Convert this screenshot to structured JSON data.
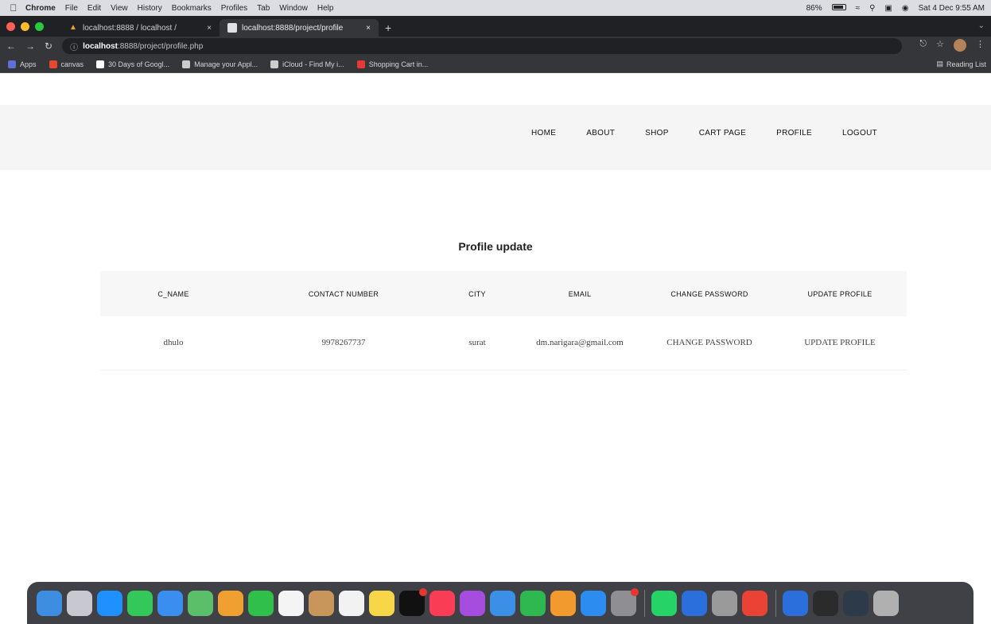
{
  "menubar": {
    "items": [
      "Chrome",
      "File",
      "Edit",
      "View",
      "History",
      "Bookmarks",
      "Profiles",
      "Tab",
      "Window",
      "Help"
    ],
    "battery": "86%",
    "clock": "Sat 4 Dec 9:55 AM"
  },
  "tabs": [
    {
      "title": "localhost:8888 / localhost / ",
      "close": "×"
    },
    {
      "title": "localhost:8888/project/profile",
      "close": "×"
    }
  ],
  "newtab": "+",
  "address": {
    "host": "localhost",
    "path": ":8888/project/profile.php"
  },
  "bookmarks": [
    {
      "label": "Apps",
      "color": "#5f6fd6"
    },
    {
      "label": "canvas",
      "color": "#e2492f"
    },
    {
      "label": "30 Days of Googl...",
      "color": "#ffffff"
    },
    {
      "label": "Manage your Appl...",
      "color": "#cccccc"
    },
    {
      "label": "iCloud - Find My i...",
      "color": "#cccccc"
    },
    {
      "label": "Shopping Cart in...",
      "color": "#e53935"
    }
  ],
  "reading_list": "Reading List",
  "nav": [
    "HOME",
    "ABOUT",
    "SHOP",
    "CART PAGE",
    "PROFILE",
    "LOGOUT"
  ],
  "heading": "Profile update",
  "table": {
    "headers": [
      "C_NAME",
      "CONTACT NUMBER",
      "CITY",
      "EMAIL",
      "CHANGE PASSWORD",
      "UPDATE PROFILE"
    ],
    "row": [
      "dhulo",
      "9978267737",
      "surat",
      "dm.narigara@gmail.com",
      "CHANGE PASSWORD",
      "UPDATE PROFILE"
    ]
  },
  "dock_icons": [
    {
      "name": "finder",
      "color": "#3d8de0"
    },
    {
      "name": "launchpad",
      "color": "#c8c8d0"
    },
    {
      "name": "safari",
      "color": "#1e90ff"
    },
    {
      "name": "messages",
      "color": "#34c759"
    },
    {
      "name": "mail",
      "color": "#3a8ef0"
    },
    {
      "name": "maps",
      "color": "#5bbf6a"
    },
    {
      "name": "photos",
      "color": "#f0a030"
    },
    {
      "name": "facetime",
      "color": "#2fbf4a"
    },
    {
      "name": "calendar",
      "color": "#f4f4f4"
    },
    {
      "name": "contacts",
      "color": "#c8965a"
    },
    {
      "name": "reminders",
      "color": "#f2f2f2"
    },
    {
      "name": "notes",
      "color": "#f7d64a"
    },
    {
      "name": "tv",
      "color": "#111111"
    },
    {
      "name": "music",
      "color": "#fa3c55"
    },
    {
      "name": "podcasts",
      "color": "#a64de0"
    },
    {
      "name": "keynote",
      "color": "#3b8fe6"
    },
    {
      "name": "numbers",
      "color": "#2fb84f"
    },
    {
      "name": "pages",
      "color": "#f29a2e"
    },
    {
      "name": "app-store",
      "color": "#2d8cf0"
    },
    {
      "name": "system-preferences",
      "color": "#8e8e93"
    },
    {
      "name": "whatsapp",
      "color": "#25d366"
    },
    {
      "name": "sketch-up",
      "color": "#2a6fdb"
    },
    {
      "name": "mamp",
      "color": "#9a9a9a"
    },
    {
      "name": "chrome",
      "color": "#ea4335"
    },
    {
      "name": "downloads",
      "color": "#2a6fdb"
    },
    {
      "name": "terminal",
      "color": "#2b2b2b"
    },
    {
      "name": "folder",
      "color": "#2d3a4a"
    },
    {
      "name": "trash",
      "color": "#b0b0b0"
    }
  ]
}
